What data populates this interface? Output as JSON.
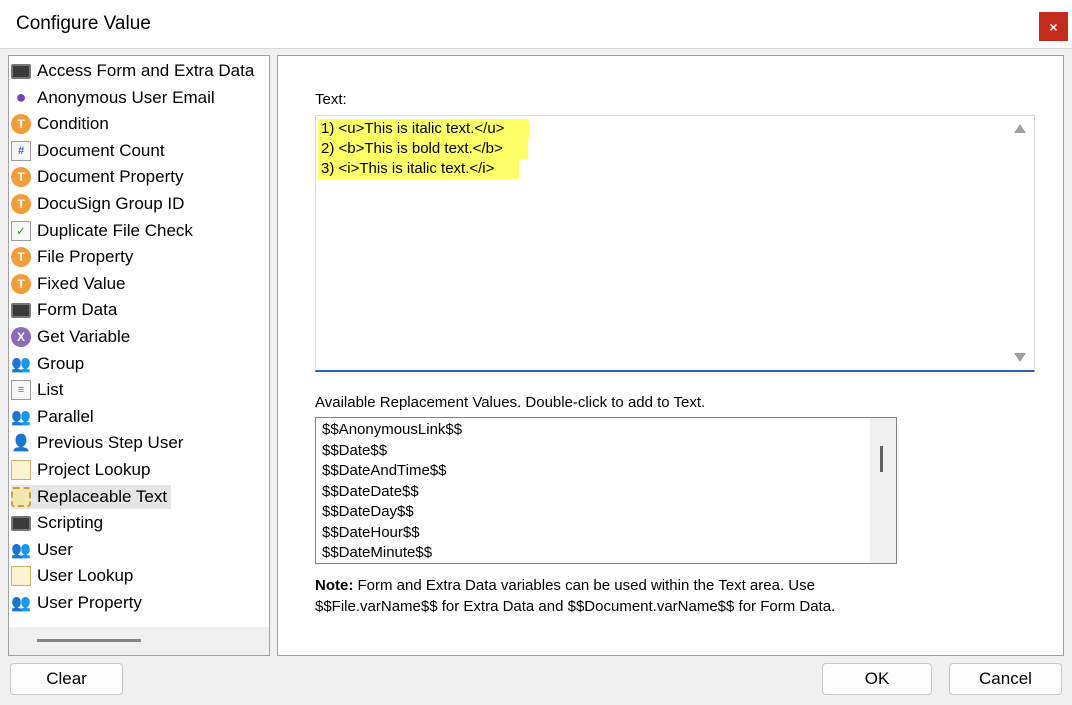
{
  "window": {
    "title": "Configure Value",
    "close_glyph": "×"
  },
  "sidebar": {
    "items": [
      {
        "label": "Access Form and Extra Data",
        "icon": "form-icon",
        "glyph": ""
      },
      {
        "label": "Anonymous User Email",
        "icon": "person-icon",
        "glyph": "●"
      },
      {
        "label": "Condition",
        "icon": "orange-t-icon",
        "glyph": "T"
      },
      {
        "label": "Document Count",
        "icon": "hash-doc-icon",
        "glyph": "#"
      },
      {
        "label": "Document Property",
        "icon": "orange-t-icon",
        "glyph": "T"
      },
      {
        "label": "DocuSign Group ID",
        "icon": "orange-t-icon",
        "glyph": "T"
      },
      {
        "label": "Duplicate File Check",
        "icon": "check-doc-icon",
        "glyph": "✓"
      },
      {
        "label": "File Property",
        "icon": "orange-t-icon",
        "glyph": "T"
      },
      {
        "label": "Fixed Value",
        "icon": "orange-t-icon",
        "glyph": "T"
      },
      {
        "label": "Form Data",
        "icon": "form-icon",
        "glyph": ""
      },
      {
        "label": "Get Variable",
        "icon": "purple-x-icon",
        "glyph": "X"
      },
      {
        "label": "Group",
        "icon": "users-icon",
        "glyph": "👥"
      },
      {
        "label": "List",
        "icon": "list-doc-icon",
        "glyph": "≡"
      },
      {
        "label": "Parallel",
        "icon": "users-icon",
        "glyph": "👥"
      },
      {
        "label": "Previous Step User",
        "icon": "user-doc-icon",
        "glyph": "👤"
      },
      {
        "label": "Project Lookup",
        "icon": "note-icon",
        "glyph": ""
      },
      {
        "label": "Replaceable Text",
        "icon": "replace-icon",
        "glyph": ""
      },
      {
        "label": "Scripting",
        "icon": "script-icon",
        "glyph": ""
      },
      {
        "label": "User",
        "icon": "users-icon",
        "glyph": "👥"
      },
      {
        "label": "User Lookup",
        "icon": "note-icon",
        "glyph": ""
      },
      {
        "label": "User Property",
        "icon": "users-icon",
        "glyph": "👥"
      }
    ],
    "selected": "Replaceable Text"
  },
  "main": {
    "text_label": "Text:",
    "text_lines": [
      "1) <u>This is italic text.</u>",
      "2) <b>This is bold text.</b>",
      "3) <i>This is italic text.</i>"
    ],
    "highlight_color": "#ffff66",
    "replacement_label": "Available Replacement Values.  Double-click to add to Text.",
    "replacement_values": [
      "$$AnonymousLink$$",
      "$$Date$$",
      "$$DateAndTime$$",
      "$$DateDate$$",
      "$$DateDay$$",
      "$$DateHour$$",
      "$$DateMinute$$"
    ],
    "note_bold": "Note:",
    "note_line1": " Form and Extra Data variables can be used within the Text area. Use",
    "note_line2": "$$File.varName$$ for Extra Data and $$Document.varName$$ for Form Data."
  },
  "footer": {
    "clear_label": "Clear",
    "ok_label": "OK",
    "cancel_label": "Cancel"
  }
}
